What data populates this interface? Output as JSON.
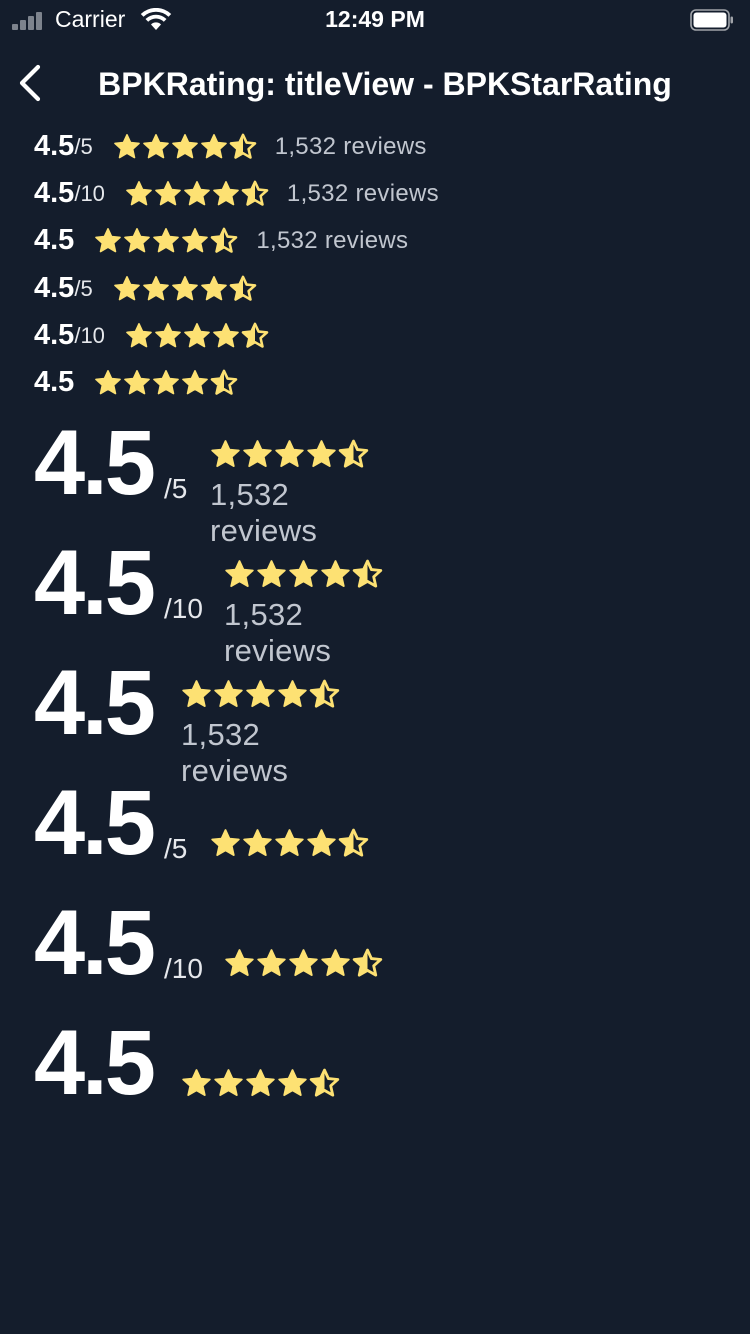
{
  "status_bar": {
    "carrier": "Carrier",
    "time": "12:49 PM",
    "signal_icon": "cellular-signal-icon",
    "wifi_icon": "wifi-icon",
    "battery_icon": "battery-icon"
  },
  "nav": {
    "back_icon": "chevron-left-icon",
    "title": "BPKRating: titleView - BPKStarRating"
  },
  "colors": {
    "background": "#141d2c",
    "star": "#fde173",
    "text_primary": "#ffffff",
    "text_secondary": "#c1c6cf"
  },
  "ratings": [
    {
      "value": "4.5",
      "scale": "/5",
      "reviews": "1,532 reviews",
      "stars": 4.5,
      "size": "small"
    },
    {
      "value": "4.5",
      "scale": "/10",
      "reviews": "1,532 reviews",
      "stars": 4.5,
      "size": "small"
    },
    {
      "value": "4.5",
      "scale": "",
      "reviews": "1,532 reviews",
      "stars": 4.5,
      "size": "small"
    },
    {
      "value": "4.5",
      "scale": "/5",
      "reviews": "",
      "stars": 4.5,
      "size": "small"
    },
    {
      "value": "4.5",
      "scale": "/10",
      "reviews": "",
      "stars": 4.5,
      "size": "small"
    },
    {
      "value": "4.5",
      "scale": "",
      "reviews": "",
      "stars": 4.5,
      "size": "small"
    },
    {
      "value": "4.5",
      "scale": "/5",
      "reviews": "1,532 reviews",
      "stars": 4.5,
      "size": "large"
    },
    {
      "value": "4.5",
      "scale": "/10",
      "reviews": "1,532 reviews",
      "stars": 4.5,
      "size": "large"
    },
    {
      "value": "4.5",
      "scale": "",
      "reviews": "1,532 reviews",
      "stars": 4.5,
      "size": "large"
    },
    {
      "value": "4.5",
      "scale": "/5",
      "reviews": "",
      "stars": 4.5,
      "size": "large"
    },
    {
      "value": "4.5",
      "scale": "/10",
      "reviews": "",
      "stars": 4.5,
      "size": "large"
    },
    {
      "value": "4.5",
      "scale": "",
      "reviews": "",
      "stars": 4.5,
      "size": "large"
    }
  ]
}
